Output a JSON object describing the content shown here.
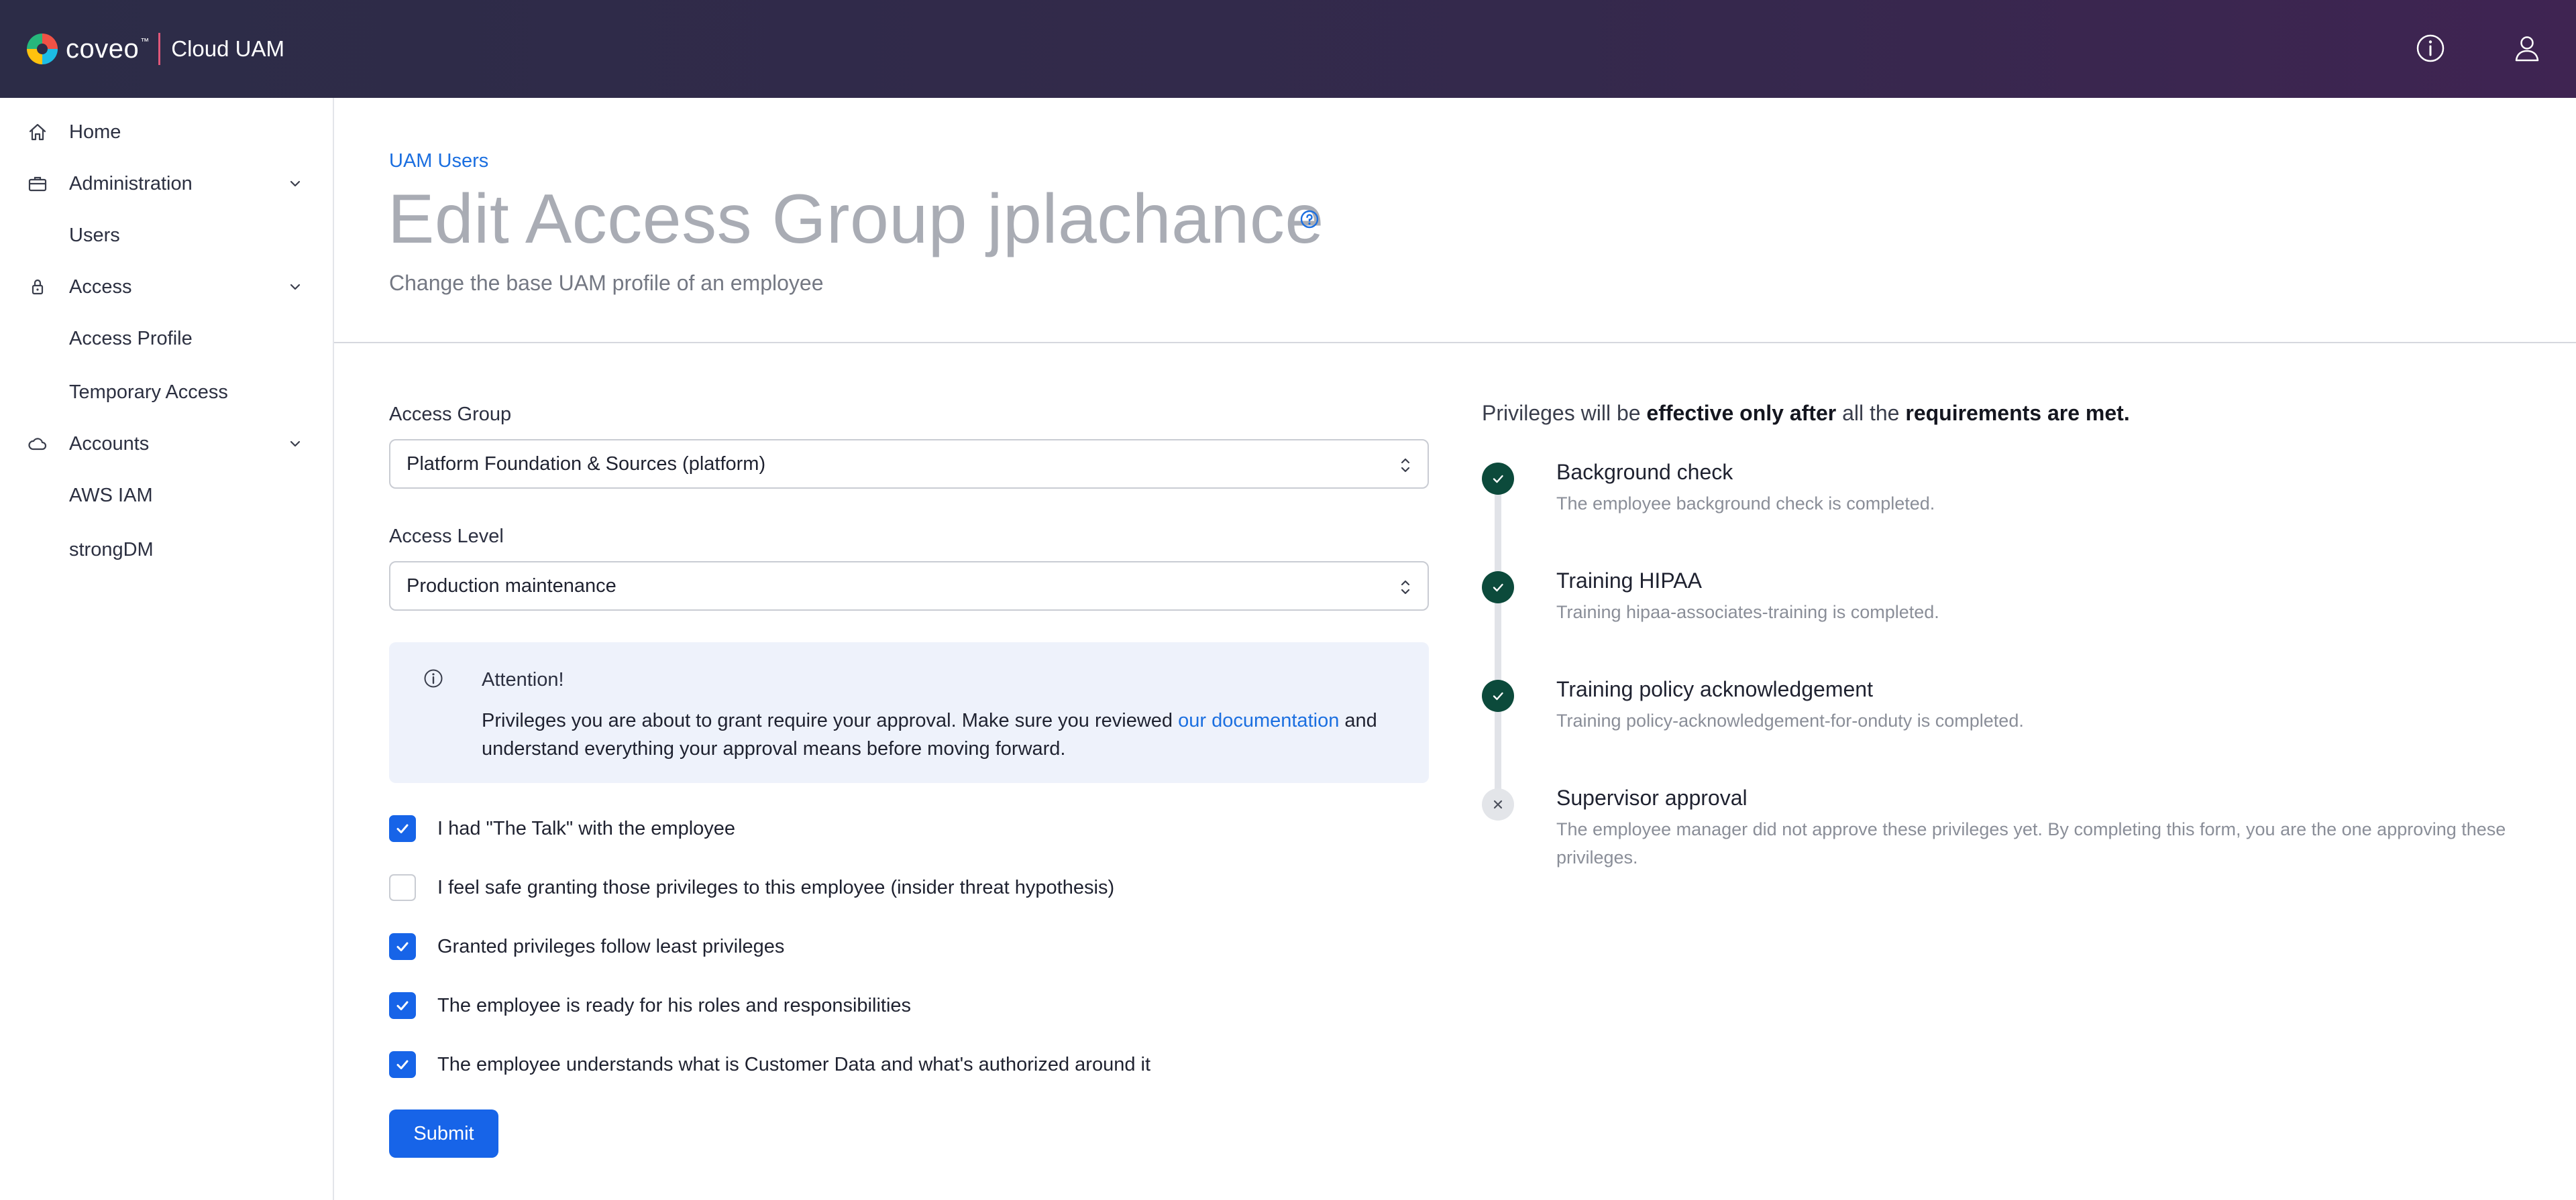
{
  "header": {
    "logo_text": "coveo",
    "logo_tm": "™",
    "app_name": "Cloud UAM",
    "info_icon": "info-circle-icon",
    "user_icon": "user-icon"
  },
  "sidebar": {
    "items": [
      {
        "label": "Home",
        "icon": "home-icon",
        "type": "top"
      },
      {
        "label": "Administration",
        "icon": "briefcase-icon",
        "type": "group"
      },
      {
        "label": "Users",
        "type": "sub"
      },
      {
        "label": "Access",
        "icon": "lock-icon",
        "type": "group"
      },
      {
        "label": "Access Profile",
        "type": "sub"
      },
      {
        "label": "Temporary Access",
        "type": "sub"
      },
      {
        "label": "Accounts",
        "icon": "cloud-icon",
        "type": "group"
      },
      {
        "label": "AWS IAM",
        "type": "sub"
      },
      {
        "label": "strongDM",
        "type": "sub"
      }
    ]
  },
  "page": {
    "breadcrumb": "UAM Users",
    "title": "Edit Access Group jplachance",
    "subtitle": "Change the base UAM profile of an employee"
  },
  "form": {
    "access_group_label": "Access Group",
    "access_group_value": "Platform Foundation & Sources (platform)",
    "access_level_label": "Access Level",
    "access_level_value": "Production maintenance",
    "alert": {
      "title": "Attention!",
      "body_before": "Privileges you are about to grant require your approval. Make sure you reviewed ",
      "link": "our documentation",
      "body_after": " and understand everything your approval means before moving forward."
    },
    "checks": [
      {
        "label": "I had \"The Talk\" with the employee",
        "checked": true
      },
      {
        "label": "I feel safe granting those privileges to this employee (insider threat hypothesis)",
        "checked": false
      },
      {
        "label": "Granted privileges follow least privileges",
        "checked": true
      },
      {
        "label": "The employee is ready for his roles and responsibilities",
        "checked": true
      },
      {
        "label": "The employee understands what is Customer Data and what's authorized around it",
        "checked": true
      }
    ],
    "submit_label": "Submit"
  },
  "requirements": {
    "intro_1": "Privileges will be ",
    "intro_2": "effective only after",
    "intro_3": " all the ",
    "intro_4": "requirements are met.",
    "steps": [
      {
        "title": "Background check",
        "desc": "The employee background check is completed.",
        "status": "done"
      },
      {
        "title": "Training HIPAA",
        "desc": "Training hipaa-associates-training is completed.",
        "status": "done"
      },
      {
        "title": "Training policy acknowledgement",
        "desc": "Training policy-acknowledgement-for-onduty is completed.",
        "status": "done"
      },
      {
        "title": "Supervisor approval",
        "desc": "The employee manager did not approve these privileges yet. By completing this form, you are the one approving these privileges.",
        "status": "pending"
      }
    ]
  },
  "colors": {
    "accent": "#1764e8",
    "link": "#1b6fe0",
    "done_step": "#0c4a3b",
    "header_start": "#2c2c47",
    "header_end": "#3f2452"
  }
}
